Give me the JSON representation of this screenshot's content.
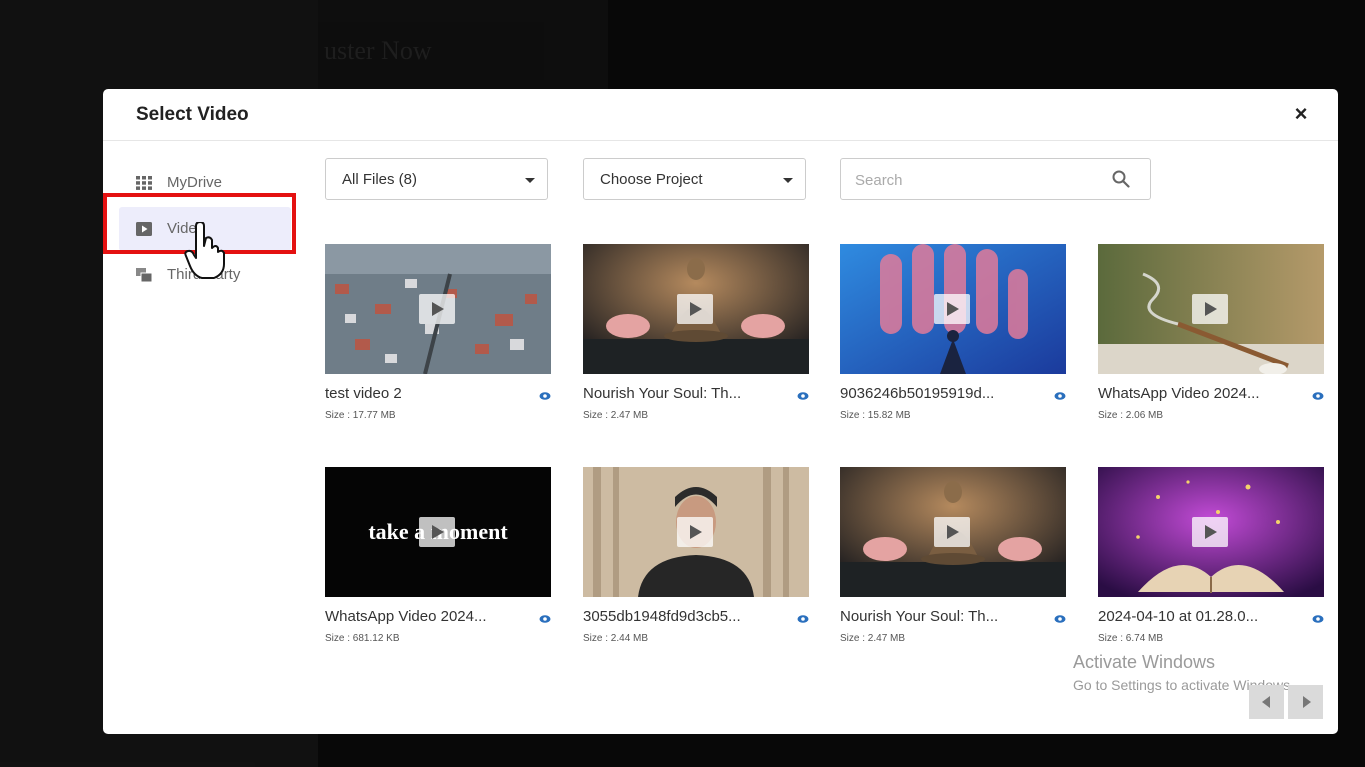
{
  "modal": {
    "title": "Select Video",
    "close_label": "×"
  },
  "sidebar": {
    "items": [
      {
        "label": "MyDrive",
        "icon": "grid-icon"
      },
      {
        "label": "Video",
        "icon": "video-icon"
      },
      {
        "label": "Third Party",
        "icon": "third-party-icon"
      }
    ]
  },
  "filters": {
    "files": "All Files (8)",
    "project": "Choose Project",
    "search_placeholder": "Search"
  },
  "videos": [
    {
      "name": "test video 2",
      "size": "Size : 17.77 MB"
    },
    {
      "name": "Nourish Your Soul: Th...",
      "size": "Size : 2.47 MB"
    },
    {
      "name": "9036246b50195919d...",
      "size": "Size : 15.82 MB"
    },
    {
      "name": "WhatsApp Video 2024...",
      "size": "Size : 2.06 MB"
    },
    {
      "name": "WhatsApp Video 2024...",
      "size": "Size : 681.12 KB",
      "thumb_text": "take a moment"
    },
    {
      "name": "3055db1948fd9d3cb5...",
      "size": "Size : 2.44 MB"
    },
    {
      "name": "Nourish Your Soul: Th...",
      "size": "Size : 2.47 MB"
    },
    {
      "name": "2024-04-10 at 01.28.0...",
      "size": "Size : 6.74 MB"
    }
  ],
  "watermark": {
    "line1": "Activate Windows",
    "line2": "Go to Settings to activate Windows."
  },
  "background": {
    "banner_text": "uster Now"
  },
  "colors": {
    "highlight": "#e41111",
    "active_bg": "#ededfb",
    "eye": "#2a6fbd"
  }
}
